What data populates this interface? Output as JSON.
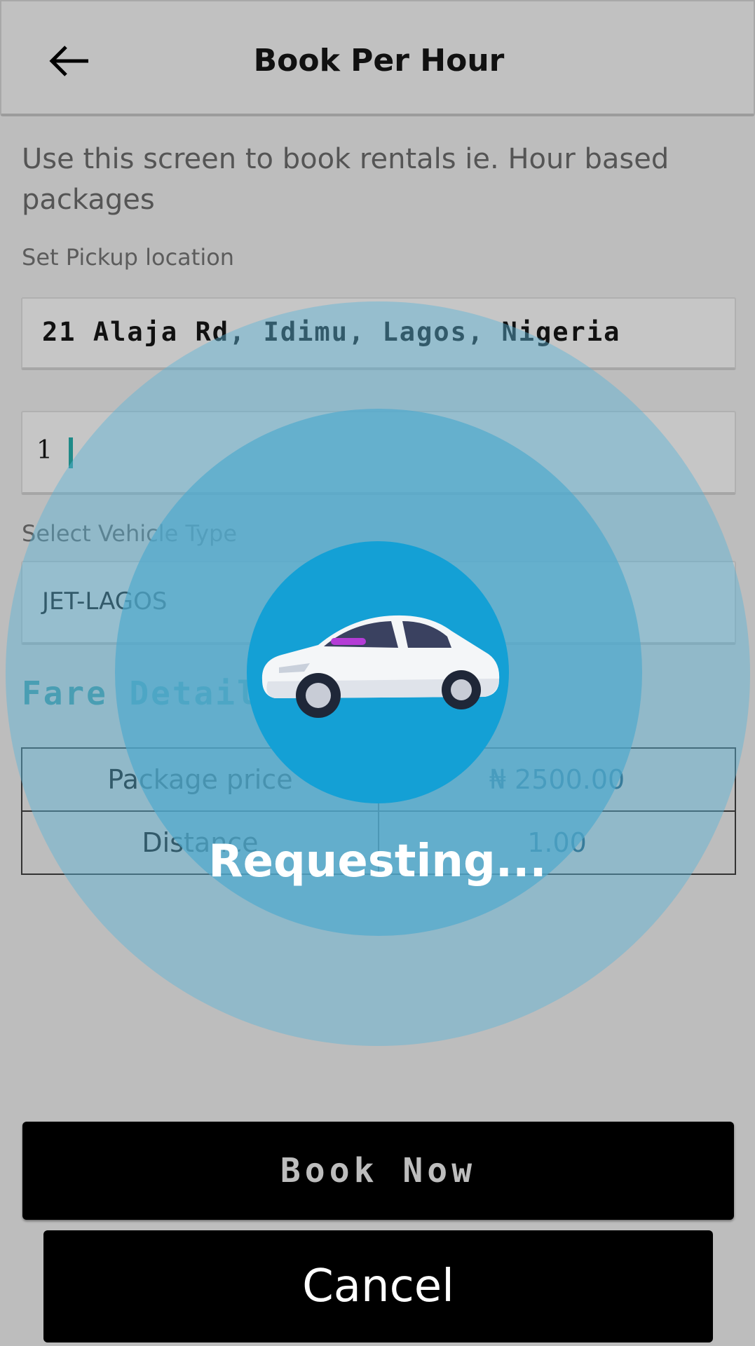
{
  "header": {
    "title": "Book Per Hour",
    "back_icon": "arrow-left-icon"
  },
  "description": "Use this screen to book rentals ie. Hour based packages",
  "pickup": {
    "label": "Set Pickup location",
    "value": "21 Alaja Rd, Idimu, Lagos, Nigeria"
  },
  "hours": {
    "value": "1"
  },
  "vehicle": {
    "label": "Select Vehicle Type",
    "value": "JET-LAGOS"
  },
  "fare": {
    "heading": "Fare Details",
    "rows": [
      {
        "label": "Package price",
        "value": "₦ 2500.00"
      },
      {
        "label": "Distance",
        "value": "1.00"
      }
    ]
  },
  "buttons": {
    "book_now": "Book Now",
    "cancel": "Cancel"
  },
  "overlay": {
    "status": "Requesting...",
    "car_icon": "car-icon"
  },
  "colors": {
    "accent": "#14a0d5",
    "teal": "#3b8c96",
    "dim_background": "#bdbdbd"
  }
}
